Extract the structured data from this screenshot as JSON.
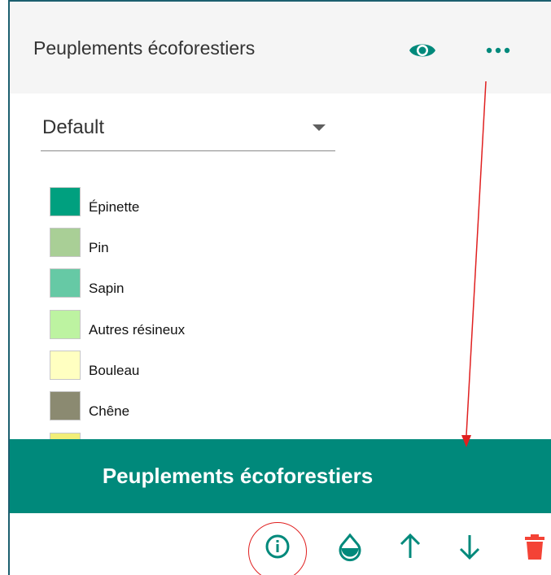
{
  "panel": {
    "title": "Peuplements écoforestiers",
    "header_icons": [
      "eye-icon",
      "more-icon"
    ]
  },
  "style_select": {
    "value": "Default"
  },
  "legend": {
    "items": [
      {
        "label": "Épinette",
        "color": "#00a07f"
      },
      {
        "label": "Pin",
        "color": "#a9cf96"
      },
      {
        "label": "Sapin",
        "color": "#66c9a5"
      },
      {
        "label": "Autres résineux",
        "color": "#bdf3a1"
      },
      {
        "label": "Bouleau",
        "color": "#ffffc1"
      },
      {
        "label": "Chêne",
        "color": "#8b8a71"
      },
      {
        "label": "",
        "color": "#f2ee78"
      }
    ]
  },
  "banner": {
    "label": "Peuplements écoforestiers"
  },
  "actions": [
    {
      "name": "info-icon"
    },
    {
      "name": "opacity-icon"
    },
    {
      "name": "arrow-up-icon"
    },
    {
      "name": "arrow-down-icon"
    },
    {
      "name": "trash-icon"
    }
  ],
  "colors": {
    "accent": "#00897b",
    "delete": "#f44336",
    "frame_border": "#1c5f6f",
    "annotation": "#e02020"
  }
}
